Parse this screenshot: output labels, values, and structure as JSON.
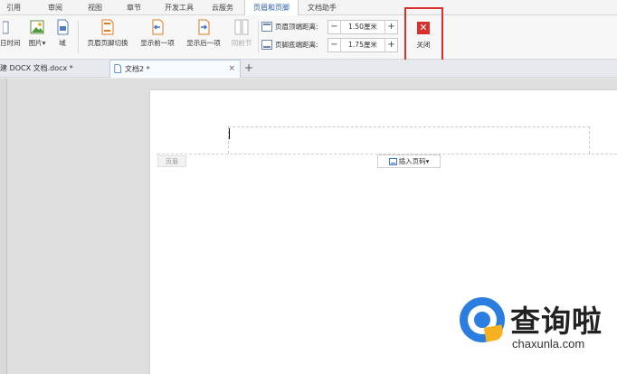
{
  "ribbon": {
    "tabs": [
      "引用",
      "审阅",
      "视图",
      "章节",
      "开发工具",
      "云服务",
      "页眉和页脚",
      "文档助手"
    ],
    "active_tab": "页眉和页脚"
  },
  "toolbar": {
    "date_time": "日时间",
    "picture": "图片",
    "picture_arrow": "▾",
    "field": "域",
    "switch_header_footer": "页眉页脚切换",
    "show_previous": "显示前一项",
    "show_next": "显示后一项",
    "same_as_previous": "同前节",
    "header_top_label": "页眉顶端距离:",
    "header_top_value": "1.50厘米",
    "footer_bottom_label": "页脚底端距离:",
    "footer_bottom_value": "1.75厘米",
    "minus": "−",
    "plus": "+",
    "close_label": "关闭",
    "close_symbol": "✕"
  },
  "doc_tabs": [
    {
      "label": "建 DOCX 文档.docx *",
      "close": "×"
    },
    {
      "label": "文档2 *",
      "close": "×"
    }
  ],
  "new_tab": "+",
  "page": {
    "header_tag": "页眉",
    "insert_page_number": "插入页码",
    "insert_arrow": "▾"
  },
  "watermark": {
    "cn": "查询啦",
    "en": "chaxunla.com"
  },
  "colors": {
    "accent": "#2a5db0",
    "close_red": "#d9302b",
    "logo_blue": "#2b7de0",
    "logo_yellow": "#f5b11f"
  }
}
